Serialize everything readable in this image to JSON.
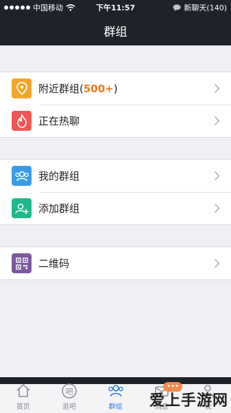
{
  "status_bar": {
    "carrier": "中国移动",
    "time": "下午11:57",
    "notification": "新聊天(140)"
  },
  "header": {
    "title": "群组"
  },
  "sections": [
    {
      "rows": [
        {
          "label": "附近群组",
          "badge": "500+",
          "icon": "location-icon",
          "color": "#f2a72a"
        },
        {
          "label": "正在热聊",
          "icon": "flame-icon",
          "color": "#ef5656"
        }
      ]
    },
    {
      "rows": [
        {
          "label": "我的群组",
          "icon": "group-icon",
          "color": "#3a9be5"
        },
        {
          "label": "添加群组",
          "icon": "add-group-icon",
          "color": "#1fb78b"
        }
      ]
    },
    {
      "rows": [
        {
          "label": "二维码",
          "icon": "qr-code-icon",
          "color": "#7d5aa0"
        }
      ]
    }
  ],
  "tabs": [
    {
      "label": "首页",
      "icon": "home-icon",
      "active": false
    },
    {
      "label": "逛吧",
      "icon": "bar-icon",
      "active": false
    },
    {
      "label": "群组",
      "icon": "group-icon",
      "active": true
    },
    {
      "label": "消息",
      "icon": "message-icon",
      "active": false,
      "badge": "•••"
    },
    {
      "label": "我",
      "icon": "profile-icon",
      "active": false
    }
  ],
  "watermark": "爱上手游网",
  "colors": {
    "accent": "#2f7ddf",
    "header_bg": "#1e2229",
    "badge_orange": "#f07a18"
  }
}
